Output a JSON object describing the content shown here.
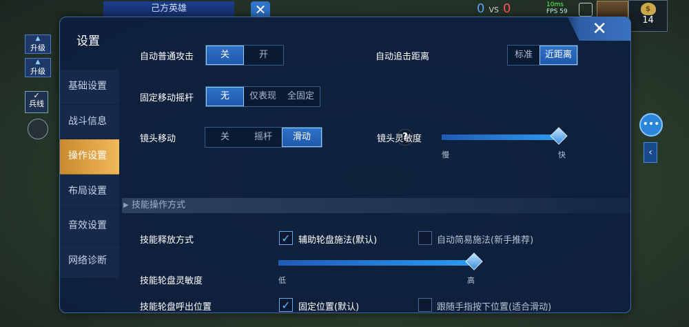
{
  "hud": {
    "team_title": "己方英雄",
    "score_blue": "0",
    "vs": "VS",
    "score_red": "0",
    "ping": "10ms",
    "fps": "FPS 59",
    "coins": "14",
    "upgrade_label": "升级",
    "minion_label": "兵线"
  },
  "dialog": {
    "title": "设置",
    "close": "✕"
  },
  "nav": {
    "items": [
      {
        "label": "基础设置"
      },
      {
        "label": "战斗信息"
      },
      {
        "label": "操作设置"
      },
      {
        "label": "布局设置"
      },
      {
        "label": "音效设置"
      },
      {
        "label": "网络诊断"
      }
    ],
    "active_index": 2
  },
  "settings": {
    "auto_attack": {
      "label": "自动普通攻击",
      "options": [
        "关",
        "开"
      ],
      "selected": "关"
    },
    "auto_chase": {
      "label": "自动追击距离",
      "options": [
        "标准",
        "近距离"
      ],
      "selected": "近距离"
    },
    "joystick": {
      "label": "固定移动摇杆",
      "options": [
        "无",
        "仅表现",
        "全固定"
      ],
      "selected": "无"
    },
    "camera_move": {
      "label": "镜头移动",
      "options": [
        "关",
        "摇杆",
        "滑动"
      ],
      "selected": "滑动"
    },
    "help": "?",
    "camera_sensitivity": {
      "label": "镜头灵敏度",
      "min_label": "慢",
      "max_label": "快",
      "value": 0.98
    },
    "section_title": "技能操作方式",
    "cast_mode": {
      "label": "技能释放方式",
      "options": [
        {
          "label": "辅助轮盘施法(默认)",
          "checked": true
        },
        {
          "label": "自动简易施法(新手推荐)",
          "checked": false
        }
      ]
    },
    "wheel_sensitivity": {
      "label": "技能轮盘灵敏度",
      "min_label": "低",
      "max_label": "高",
      "value": 1.0
    },
    "wheel_position": {
      "label": "技能轮盘呼出位置",
      "options": [
        {
          "label": "固定位置(默认)",
          "checked": true
        },
        {
          "label": "跟随手指按下位置(适合滑动)",
          "checked": false
        }
      ]
    }
  },
  "colors": {
    "accent_blue": "#2f72c8",
    "active_nav": "#e0a446",
    "dialog_bg": "#0c1e3e"
  }
}
